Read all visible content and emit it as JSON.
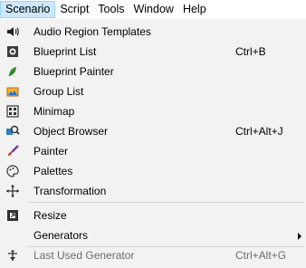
{
  "menubar": {
    "items": [
      {
        "label": "Scenario",
        "active": true
      },
      {
        "label": "Script"
      },
      {
        "label": "Tools"
      },
      {
        "label": "Window"
      },
      {
        "label": "Help"
      }
    ]
  },
  "menu": {
    "items": [
      {
        "label": "Audio Region Templates",
        "shortcut": "",
        "icon": "speaker-icon"
      },
      {
        "label": "Blueprint List",
        "shortcut": "Ctrl+B",
        "icon": "blueprint-list-icon"
      },
      {
        "label": "Blueprint Painter",
        "shortcut": "",
        "icon": "leaf-icon"
      },
      {
        "label": "Group List",
        "shortcut": "",
        "icon": "group-list-icon"
      },
      {
        "label": "Minimap",
        "shortcut": "",
        "icon": "minimap-icon"
      },
      {
        "label": "Object Browser",
        "shortcut": "Ctrl+Alt+J",
        "icon": "object-browser-icon"
      },
      {
        "label": "Painter",
        "shortcut": "",
        "icon": "paint-brush-icon"
      },
      {
        "label": "Palettes",
        "shortcut": "",
        "icon": "palette-icon"
      },
      {
        "label": "Transformation",
        "shortcut": "",
        "icon": "move-arrows-icon"
      },
      {
        "label": "Resize",
        "shortcut": "",
        "icon": "resize-icon"
      },
      {
        "label": "Generators",
        "shortcut": "",
        "icon": "",
        "submenu": true
      },
      {
        "label": "Last Used Generator",
        "shortcut": "Ctrl+Alt+G",
        "icon": "generator-icon",
        "disabled": true
      }
    ]
  }
}
